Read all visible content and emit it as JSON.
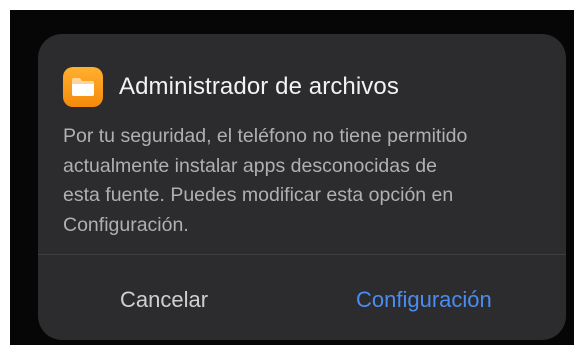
{
  "dialog": {
    "app_icon": "folder-icon",
    "title": "Administrador de archivos",
    "message_lines": [
      "Por tu seguridad, el teléfono no tiene permitido",
      "actualmente instalar apps desconocidas de",
      "esta fuente. Puedes modificar esta opción en",
      "Configuración."
    ],
    "cancel_label": "Cancelar",
    "settings_label": "Configuración"
  },
  "colors": {
    "background": "#060606",
    "dialog": "#2c2c2e",
    "accent": "#4a8cf0",
    "icon": "#f99a18"
  }
}
